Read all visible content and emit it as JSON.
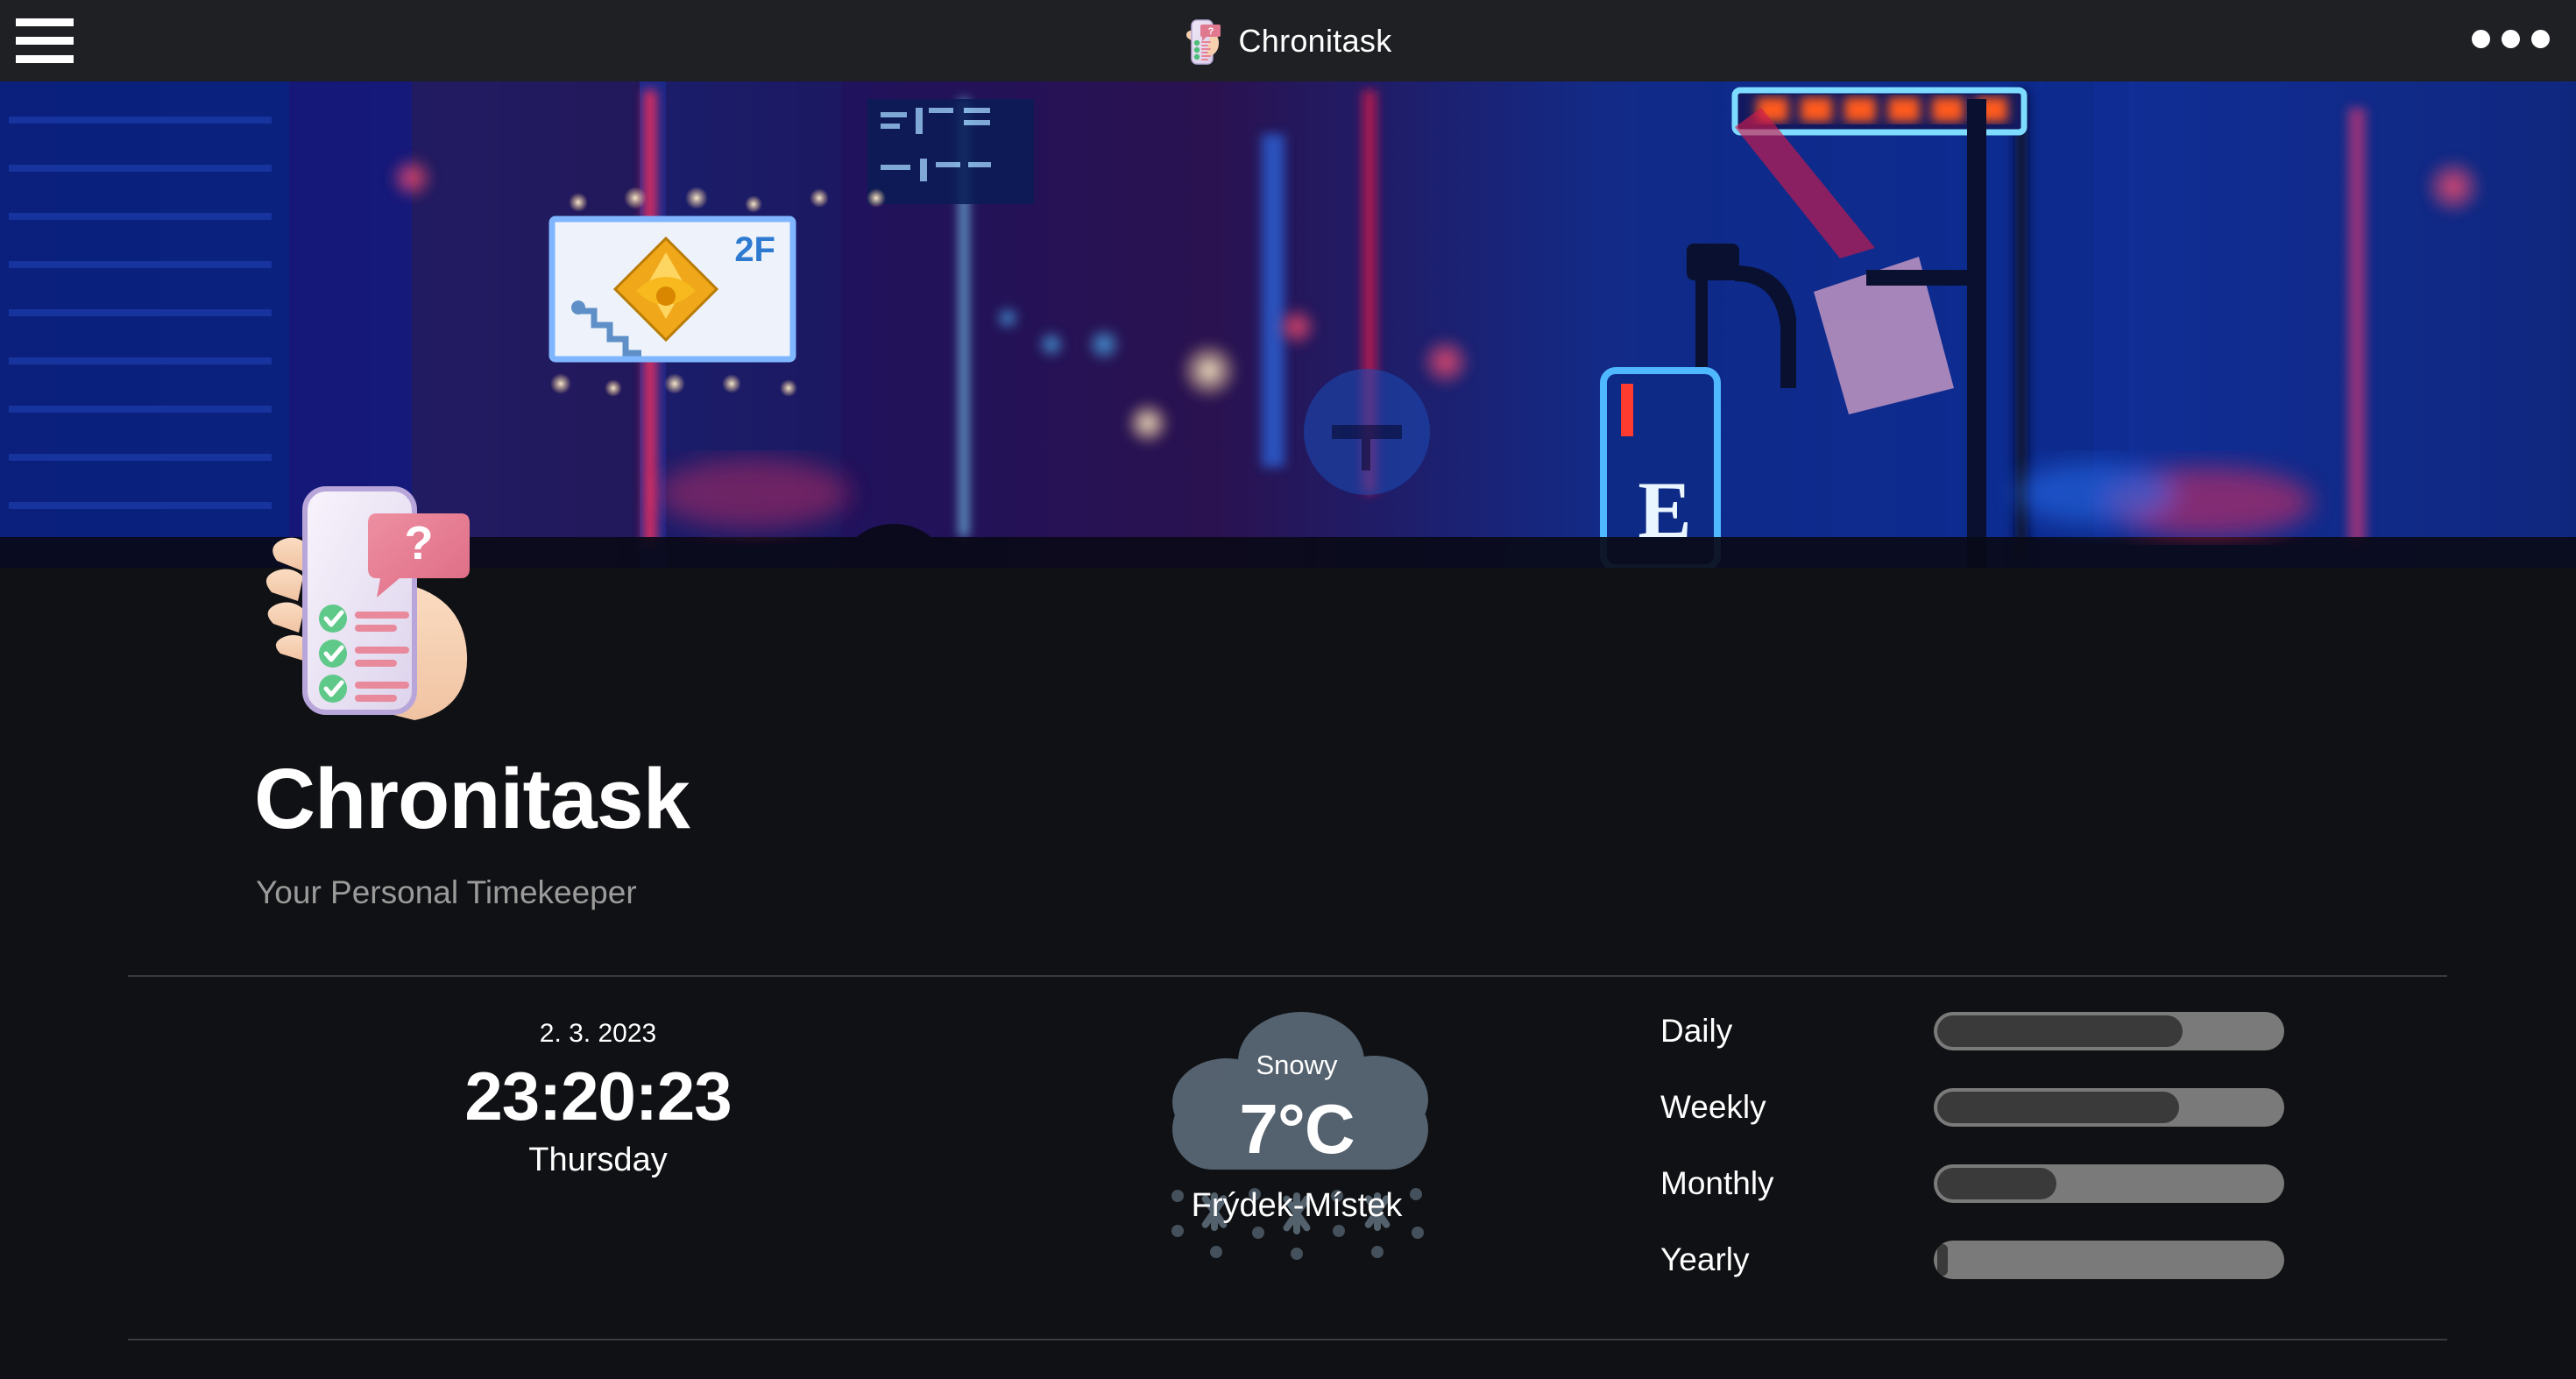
{
  "window": {
    "menu_icon": "hamburger-icon",
    "title": "Chronitask",
    "overflow_icon": "kebab-menu-icon"
  },
  "hero": {
    "alt": "neon-city-street-night",
    "sign_text": "2F",
    "sign_text_2": "E"
  },
  "app": {
    "logo": "phone-checklist-icon",
    "name": "Chronitask",
    "tagline": "Your Personal Timekeeper"
  },
  "clock": {
    "date": "2. 3. 2023",
    "time": "23:20:23",
    "weekday": "Thursday"
  },
  "weather": {
    "icon": "snow-cloud-icon",
    "condition": "Snowy",
    "temperature": "7°C",
    "location": "Frýdek-Místek"
  },
  "progress": {
    "items": [
      {
        "label": "Daily",
        "percent": 72
      },
      {
        "label": "Weekly",
        "percent": 71
      },
      {
        "label": "Monthly",
        "percent": 36
      },
      {
        "label": "Yearly",
        "percent": 5
      }
    ]
  },
  "colors": {
    "background": "#101114",
    "topbar": "#1f2024",
    "text_primary": "#ffffff",
    "text_secondary": "#9b9b9b",
    "divider": "#3a3b3e",
    "track": "#7a7a7a",
    "fill": "#3a3a3a"
  }
}
